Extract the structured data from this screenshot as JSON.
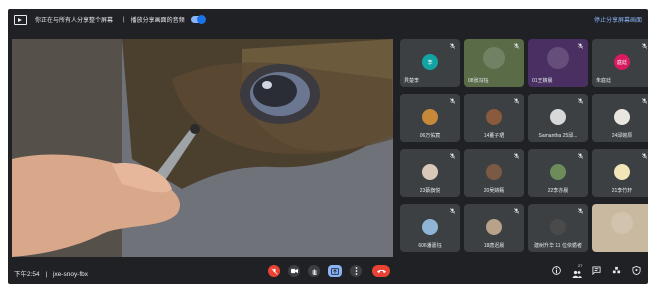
{
  "topbar": {
    "share_status": "你正在与所有人分享整个屏幕",
    "separator": "|",
    "share_audio": "播放分享画面的音频",
    "stop_sharing": "停止分享屏幕画面"
  },
  "participants": [
    {
      "name": "貝楚李",
      "avatar_text": "李",
      "avatar_color": "#12a4a4"
    },
    {
      "name": "08张冯钰",
      "avatar_text": "",
      "avatar_color": "#5a6b48"
    },
    {
      "name": "01王婧晨",
      "avatar_text": "",
      "avatar_color": "#4a2f63"
    },
    {
      "name": "朱庭廷",
      "avatar_text": "庭廷",
      "avatar_color": "#d81b60"
    },
    {
      "name": "06万佑宸",
      "avatar_text": "",
      "avatar_color": "#c7883a"
    },
    {
      "name": "14董子珺",
      "avatar_text": "",
      "avatar_color": "#8a5a3c"
    },
    {
      "name": "Samantha 25邱...",
      "avatar_text": "",
      "avatar_color": "#d8d8d8"
    },
    {
      "name": "24邱婉辰",
      "avatar_text": "",
      "avatar_color": "#e9e5df"
    },
    {
      "name": "23蔡旗悦",
      "avatar_text": "",
      "avatar_color": "#d9c7b8"
    },
    {
      "name": "20吴婧甄",
      "avatar_text": "",
      "avatar_color": "#7a5a45"
    },
    {
      "name": "22李亦晨",
      "avatar_text": "",
      "avatar_color": "#6d8c5a"
    },
    {
      "name": "21李竹轩",
      "avatar_text": "",
      "avatar_color": "#f2e6b8"
    },
    {
      "name": "606潘嘉钰",
      "avatar_text": "",
      "avatar_color": "#8fb4d6"
    },
    {
      "name": "18唐迟晨",
      "avatar_text": "",
      "avatar_color": "#b9a28a"
    },
    {
      "name": "建树升华 11 位依循者",
      "avatar_text": "",
      "avatar_color": "#4a4a4a"
    },
    {
      "name": "",
      "avatar_text": "",
      "avatar_color": "#c9b9a0"
    }
  ],
  "bottombar": {
    "time": "下午2:54",
    "divider": "|",
    "meeting_code": "jxe-snoy-fbx",
    "people_count": "27"
  },
  "colors": {
    "background": "#202124",
    "tile": "#3c4043",
    "accent_blue": "#8ab4f8",
    "end_call_red": "#ea4335"
  },
  "icons": [
    "present-icon",
    "toggle",
    "mic-off-icon",
    "camera-icon",
    "raise-hand-icon",
    "present-screen-icon",
    "more-options-icon",
    "end-call-icon",
    "info-icon",
    "people-icon",
    "chat-icon",
    "activities-icon",
    "host-controls-icon"
  ]
}
